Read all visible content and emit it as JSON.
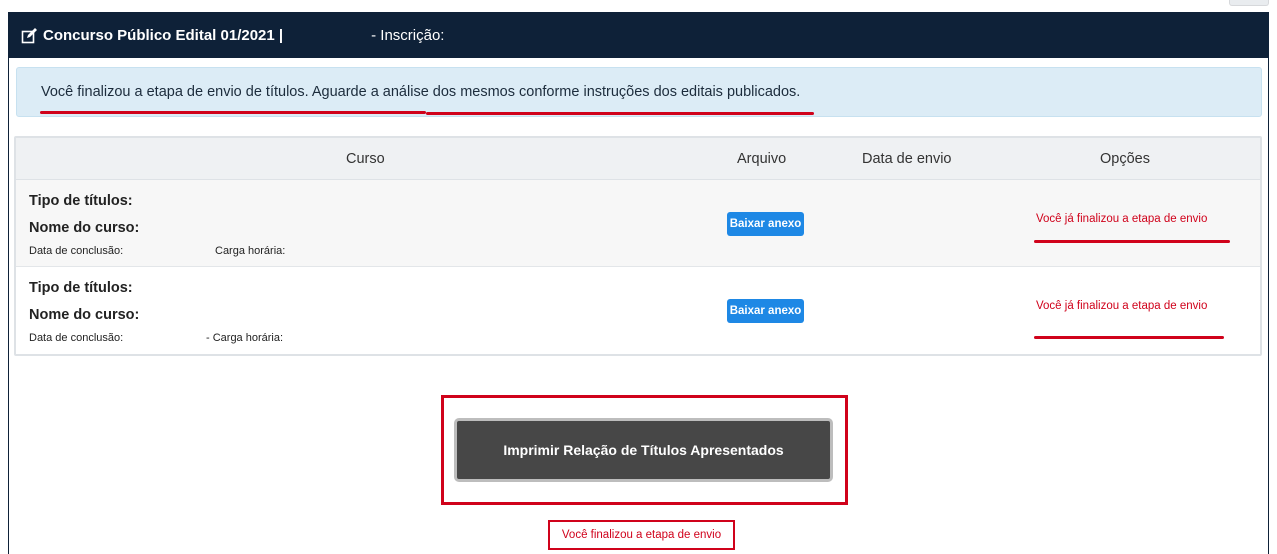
{
  "header": {
    "title": "Concurso Público Edital 01/2021 |",
    "inscricao": "- Inscrição:"
  },
  "alert": {
    "message": "Você finalizou a etapa de envio de títulos. Aguarde a análise dos mesmos conforme instruções dos editais publicados."
  },
  "table": {
    "columns": [
      "Curso",
      "Arquivo",
      "Data de envio",
      "Opções"
    ],
    "rows": [
      {
        "tipo": "Tipo de títulos:",
        "nome": "Nome do curso:",
        "data_conclusao": "Data de conclusão:",
        "carga": "Carga horária:",
        "button": "Baixar anexo",
        "option": "Você já finalizou a etapa de envio"
      },
      {
        "tipo": "Tipo de títulos:",
        "nome": "Nome do curso:",
        "data_conclusao": "Data de conclusão:",
        "carga": "- Carga horária:",
        "button": "Baixar anexo",
        "option": "Você já finalizou a etapa de envio"
      }
    ]
  },
  "print_button": "Imprimir Relação de Títulos Apresentados",
  "final_message": "Você finalizou a etapa de envio",
  "colors": {
    "header_bg": "#0e2138",
    "accent_red": "#d0021b",
    "button_blue": "#1e88e5",
    "alert_bg": "#dcecf6"
  },
  "icons": {
    "header": "edit-icon"
  }
}
